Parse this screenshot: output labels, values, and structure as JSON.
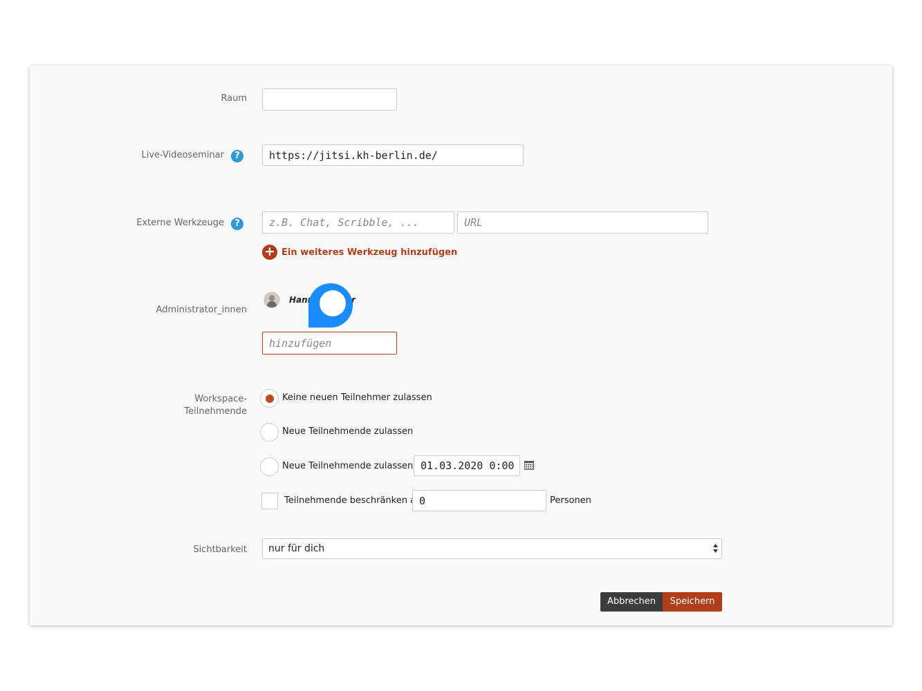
{
  "form": {
    "raum": {
      "label": "Raum",
      "value": ""
    },
    "video": {
      "label": "Live-Videoseminar",
      "help_icon": "question-icon",
      "help_glyph": "?",
      "value": "https://jitsi.kh-berlin.de/"
    },
    "tools": {
      "label": "Externe Werkzeuge",
      "help_icon": "question-icon",
      "help_glyph": "?",
      "name_placeholder": "z.B. Chat, Scribble, ...",
      "url_placeholder": "URL",
      "add_glyph": "+",
      "add_label": "Ein weiteres Werkzeug hinzufügen"
    },
    "admins": {
      "label": "Administrator_innen",
      "user_name_prefix": "Hann",
      "user_name_suffix": "r",
      "add_placeholder": "hinzufügen"
    },
    "participants": {
      "label_line1": "Workspace-",
      "label_line2": "Teilnehmende",
      "options": [
        {
          "label": "Keine neuen Teilnehmer zulassen",
          "selected": true
        },
        {
          "label": "Neue Teilnehmende zulassen",
          "selected": false
        },
        {
          "label": "Neue Teilnehmende zulassen ab",
          "selected": false
        }
      ],
      "date_value": "01.03.2020 0:00",
      "calendar_icon": "calendar-icon",
      "limit_label": "Teilnehmende beschränken auf",
      "limit_value": "0",
      "limit_unit": "Personen",
      "limit_checked": false
    },
    "visibility": {
      "label": "Sichtbarkeit",
      "value": "nur für dich"
    }
  },
  "buttons": {
    "cancel": "Abbrechen",
    "save": "Speichern"
  },
  "colors": {
    "accent": "#b03e1a",
    "radio_selected": "#c0461f",
    "help": "#2c9ad6",
    "cursor": "#1a8cff",
    "cancel_bg": "#3c3c3c"
  }
}
